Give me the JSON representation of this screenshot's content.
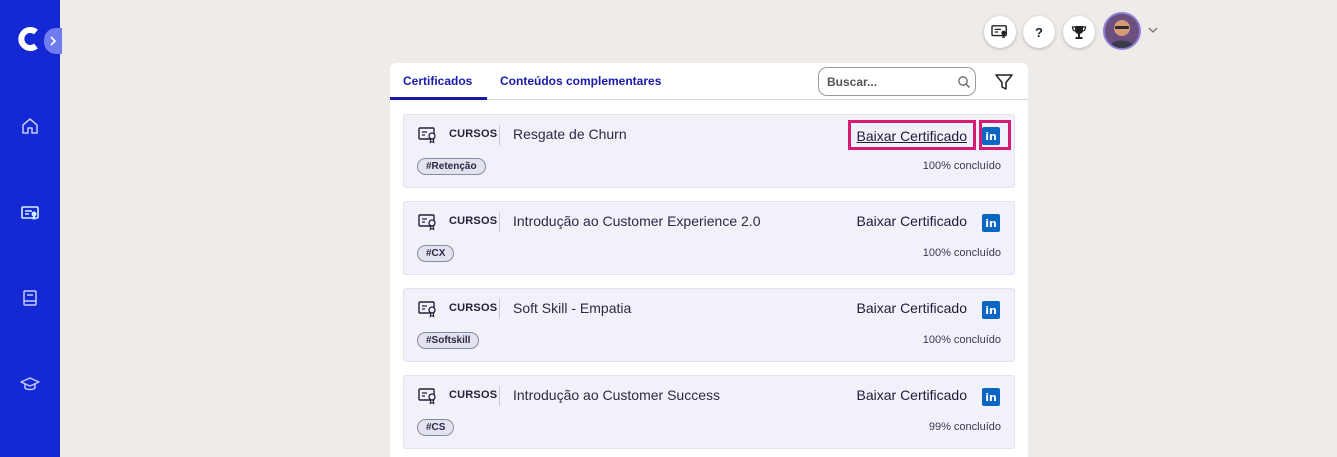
{
  "sidebar": {
    "logo": "c-logo",
    "expand_icon": "chevron-right-icon",
    "items": [
      {
        "icon": "home-icon"
      },
      {
        "icon": "certificate-icon",
        "active": true
      },
      {
        "icon": "book-icon"
      },
      {
        "icon": "graduation-cap-icon"
      }
    ]
  },
  "topbar": {
    "certificate_button_icon": "certificate-icon",
    "help_label": "?",
    "trophy_icon": "trophy-icon",
    "avatar_icon": "avatar",
    "avatar_menu_icon": "chevron-down-icon"
  },
  "tabs": [
    {
      "label": "Certificados",
      "active": true
    },
    {
      "label": "Conteúdos complementares",
      "active": false
    }
  ],
  "search": {
    "placeholder": "Buscar..."
  },
  "filter_icon": "filter-icon",
  "colors": {
    "sidebar": "#1428d4",
    "accent": "#1a1aa8",
    "highlight": "#d81b72",
    "linkedin": "#0a66c2"
  },
  "cards": [
    {
      "type": "CURSOS",
      "title": "Resgate de Churn",
      "download_label": "Baixar Certificado",
      "tag": "#Retenção",
      "progress": "100% concluído",
      "linkedin_label": "in"
    },
    {
      "type": "CURSOS",
      "title": "Introdução ao Customer Experience 2.0",
      "download_label": "Baixar Certificado",
      "tag": "#CX",
      "progress": "100% concluído",
      "linkedin_label": "in"
    },
    {
      "type": "CURSOS",
      "title": "Soft Skill - Empatia",
      "download_label": "Baixar Certificado",
      "tag": "#Softskill",
      "progress": "100% concluído",
      "linkedin_label": "in"
    },
    {
      "type": "CURSOS",
      "title": "Introdução ao Customer Success",
      "download_label": "Baixar Certificado",
      "tag": "#CS",
      "progress": "99% concluído",
      "linkedin_label": "in"
    }
  ]
}
